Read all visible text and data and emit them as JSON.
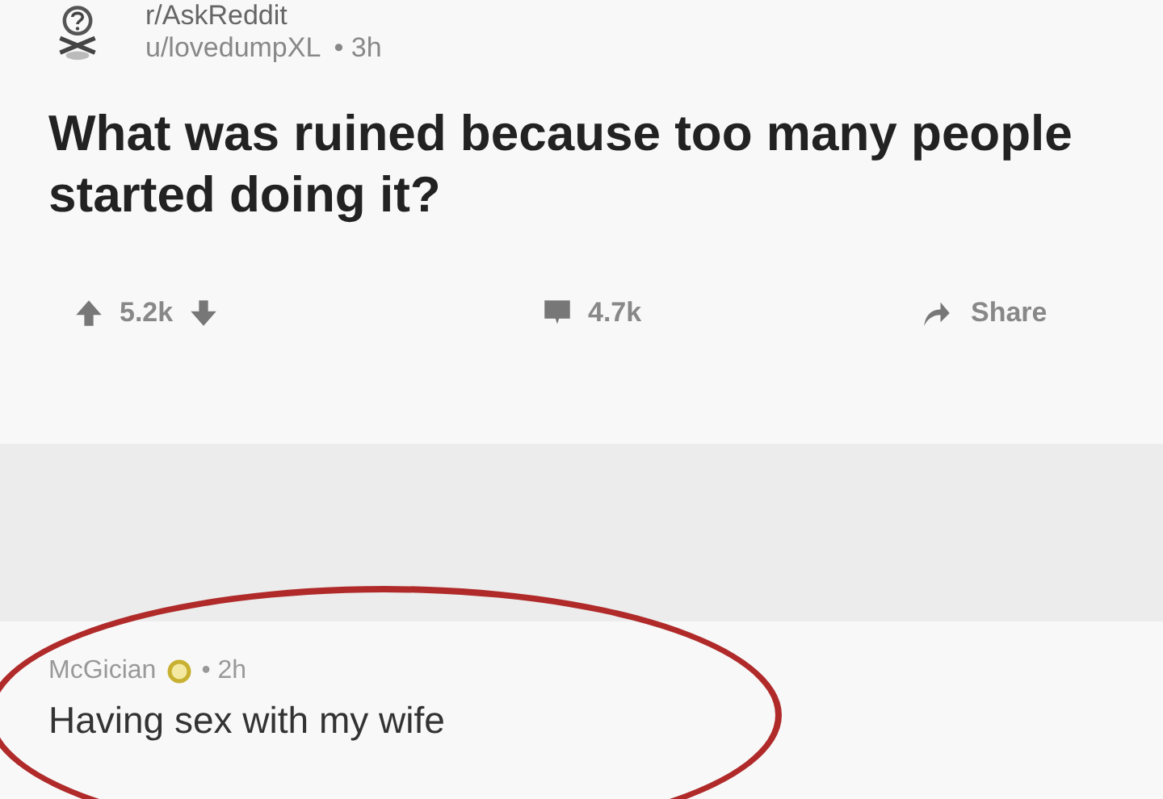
{
  "post": {
    "subreddit": "r/AskReddit",
    "author": "u/lovedumpXL",
    "time": "• 3h",
    "title": "What was ruined because too many people started doing it?",
    "votes": "5.2k",
    "comments": "4.7k",
    "share": "Share"
  },
  "comment": {
    "author": "McGician",
    "time": "• 2h",
    "body": "Having sex with my wife",
    "circled": true
  }
}
